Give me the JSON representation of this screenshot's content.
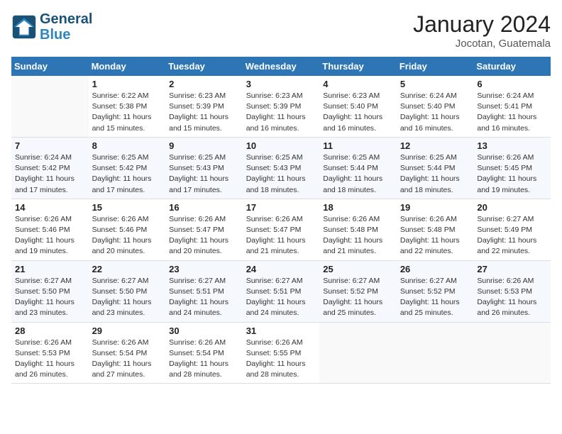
{
  "header": {
    "logo_line1": "General",
    "logo_line2": "Blue",
    "month": "January 2024",
    "location": "Jocotan, Guatemala"
  },
  "weekdays": [
    "Sunday",
    "Monday",
    "Tuesday",
    "Wednesday",
    "Thursday",
    "Friday",
    "Saturday"
  ],
  "weeks": [
    [
      {
        "day": "",
        "sunrise": "",
        "sunset": "",
        "daylight": ""
      },
      {
        "day": "1",
        "sunrise": "6:22 AM",
        "sunset": "5:38 PM",
        "daylight": "11 hours and 15 minutes."
      },
      {
        "day": "2",
        "sunrise": "6:23 AM",
        "sunset": "5:39 PM",
        "daylight": "11 hours and 15 minutes."
      },
      {
        "day": "3",
        "sunrise": "6:23 AM",
        "sunset": "5:39 PM",
        "daylight": "11 hours and 16 minutes."
      },
      {
        "day": "4",
        "sunrise": "6:23 AM",
        "sunset": "5:40 PM",
        "daylight": "11 hours and 16 minutes."
      },
      {
        "day": "5",
        "sunrise": "6:24 AM",
        "sunset": "5:40 PM",
        "daylight": "11 hours and 16 minutes."
      },
      {
        "day": "6",
        "sunrise": "6:24 AM",
        "sunset": "5:41 PM",
        "daylight": "11 hours and 16 minutes."
      }
    ],
    [
      {
        "day": "7",
        "sunrise": "6:24 AM",
        "sunset": "5:42 PM",
        "daylight": "11 hours and 17 minutes."
      },
      {
        "day": "8",
        "sunrise": "6:25 AM",
        "sunset": "5:42 PM",
        "daylight": "11 hours and 17 minutes."
      },
      {
        "day": "9",
        "sunrise": "6:25 AM",
        "sunset": "5:43 PM",
        "daylight": "11 hours and 17 minutes."
      },
      {
        "day": "10",
        "sunrise": "6:25 AM",
        "sunset": "5:43 PM",
        "daylight": "11 hours and 18 minutes."
      },
      {
        "day": "11",
        "sunrise": "6:25 AM",
        "sunset": "5:44 PM",
        "daylight": "11 hours and 18 minutes."
      },
      {
        "day": "12",
        "sunrise": "6:25 AM",
        "sunset": "5:44 PM",
        "daylight": "11 hours and 18 minutes."
      },
      {
        "day": "13",
        "sunrise": "6:26 AM",
        "sunset": "5:45 PM",
        "daylight": "11 hours and 19 minutes."
      }
    ],
    [
      {
        "day": "14",
        "sunrise": "6:26 AM",
        "sunset": "5:46 PM",
        "daylight": "11 hours and 19 minutes."
      },
      {
        "day": "15",
        "sunrise": "6:26 AM",
        "sunset": "5:46 PM",
        "daylight": "11 hours and 20 minutes."
      },
      {
        "day": "16",
        "sunrise": "6:26 AM",
        "sunset": "5:47 PM",
        "daylight": "11 hours and 20 minutes."
      },
      {
        "day": "17",
        "sunrise": "6:26 AM",
        "sunset": "5:47 PM",
        "daylight": "11 hours and 21 minutes."
      },
      {
        "day": "18",
        "sunrise": "6:26 AM",
        "sunset": "5:48 PM",
        "daylight": "11 hours and 21 minutes."
      },
      {
        "day": "19",
        "sunrise": "6:26 AM",
        "sunset": "5:48 PM",
        "daylight": "11 hours and 22 minutes."
      },
      {
        "day": "20",
        "sunrise": "6:27 AM",
        "sunset": "5:49 PM",
        "daylight": "11 hours and 22 minutes."
      }
    ],
    [
      {
        "day": "21",
        "sunrise": "6:27 AM",
        "sunset": "5:50 PM",
        "daylight": "11 hours and 23 minutes."
      },
      {
        "day": "22",
        "sunrise": "6:27 AM",
        "sunset": "5:50 PM",
        "daylight": "11 hours and 23 minutes."
      },
      {
        "day": "23",
        "sunrise": "6:27 AM",
        "sunset": "5:51 PM",
        "daylight": "11 hours and 24 minutes."
      },
      {
        "day": "24",
        "sunrise": "6:27 AM",
        "sunset": "5:51 PM",
        "daylight": "11 hours and 24 minutes."
      },
      {
        "day": "25",
        "sunrise": "6:27 AM",
        "sunset": "5:52 PM",
        "daylight": "11 hours and 25 minutes."
      },
      {
        "day": "26",
        "sunrise": "6:27 AM",
        "sunset": "5:52 PM",
        "daylight": "11 hours and 25 minutes."
      },
      {
        "day": "27",
        "sunrise": "6:26 AM",
        "sunset": "5:53 PM",
        "daylight": "11 hours and 26 minutes."
      }
    ],
    [
      {
        "day": "28",
        "sunrise": "6:26 AM",
        "sunset": "5:53 PM",
        "daylight": "11 hours and 26 minutes."
      },
      {
        "day": "29",
        "sunrise": "6:26 AM",
        "sunset": "5:54 PM",
        "daylight": "11 hours and 27 minutes."
      },
      {
        "day": "30",
        "sunrise": "6:26 AM",
        "sunset": "5:54 PM",
        "daylight": "11 hours and 28 minutes."
      },
      {
        "day": "31",
        "sunrise": "6:26 AM",
        "sunset": "5:55 PM",
        "daylight": "11 hours and 28 minutes."
      },
      {
        "day": "",
        "sunrise": "",
        "sunset": "",
        "daylight": ""
      },
      {
        "day": "",
        "sunrise": "",
        "sunset": "",
        "daylight": ""
      },
      {
        "day": "",
        "sunrise": "",
        "sunset": "",
        "daylight": ""
      }
    ]
  ],
  "labels": {
    "sunrise": "Sunrise:",
    "sunset": "Sunset:",
    "daylight": "Daylight:"
  }
}
